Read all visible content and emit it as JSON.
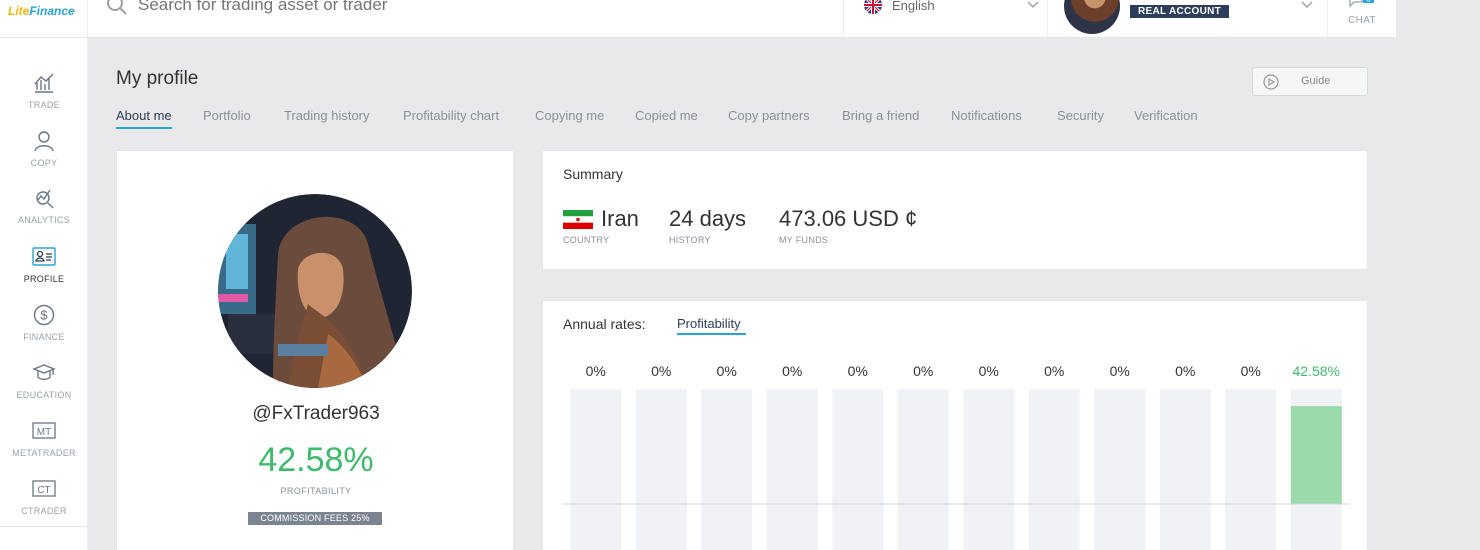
{
  "header": {
    "logo_text_a": "Lite",
    "logo_text_b": "Finance",
    "search_placeholder": "Search for trading asset or trader",
    "language": "English",
    "account_badge": "REAL ACCOUNT",
    "chat_label": "CHAT",
    "chat_count": "5"
  },
  "sidebar": {
    "items": [
      {
        "label": "TRADE",
        "icon": "trade-chart-icon"
      },
      {
        "label": "COPY",
        "icon": "copy-user-icon"
      },
      {
        "label": "ANALYTICS",
        "icon": "analytics-icon"
      },
      {
        "label": "PROFILE",
        "icon": "profile-card-icon"
      },
      {
        "label": "FINANCE",
        "icon": "dollar-icon"
      },
      {
        "label": "EDUCATION",
        "icon": "graduation-cap-icon"
      },
      {
        "label": "METATRADER",
        "icon": "mt-icon",
        "glyph": "MT"
      },
      {
        "label": "CTRADER",
        "icon": "ct-icon",
        "glyph": "CT"
      }
    ],
    "active": "PROFILE"
  },
  "main": {
    "title": "My profile",
    "guide_label": "Guide",
    "tabs": [
      "About me",
      "Portfolio",
      "Trading history",
      "Profitability chart",
      "Copying me",
      "Copied me",
      "Copy partners",
      "Bring a friend",
      "Notifications",
      "Security",
      "Verification"
    ],
    "active_tab": "About me"
  },
  "profile": {
    "username": "@FxTrader963",
    "profitability": "42.58%",
    "profitability_label": "PROFITABILITY",
    "commission": "COMMISSION FEES 25%"
  },
  "summary": {
    "title": "Summary",
    "country": "Iran",
    "country_label": "COUNTRY",
    "history": "24 days",
    "history_label": "HISTORY",
    "funds": "473.06 USD ¢",
    "funds_label": "MY FUNDS"
  },
  "rates": {
    "title": "Annual rates:",
    "tab": "Profitability"
  },
  "colors": {
    "accent": "#2aa3d8",
    "positive": "#3fba6c",
    "bar_fill": "#9bdbab",
    "bar_bg": "#f0f2f5"
  },
  "chart_data": {
    "type": "bar",
    "categories": [
      "",
      "",
      "",
      "",
      "",
      "",
      "",
      "",
      "",
      "",
      "",
      ""
    ],
    "values": [
      0,
      0,
      0,
      0,
      0,
      0,
      0,
      0,
      0,
      0,
      0,
      42.58
    ],
    "value_labels": [
      "0%",
      "0%",
      "0%",
      "0%",
      "0%",
      "0%",
      "0%",
      "0%",
      "0%",
      "0%",
      "0%",
      "42.58%"
    ],
    "title": "",
    "xlabel": "",
    "ylabel": "",
    "ylim": [
      -50,
      50
    ],
    "grid": false
  }
}
